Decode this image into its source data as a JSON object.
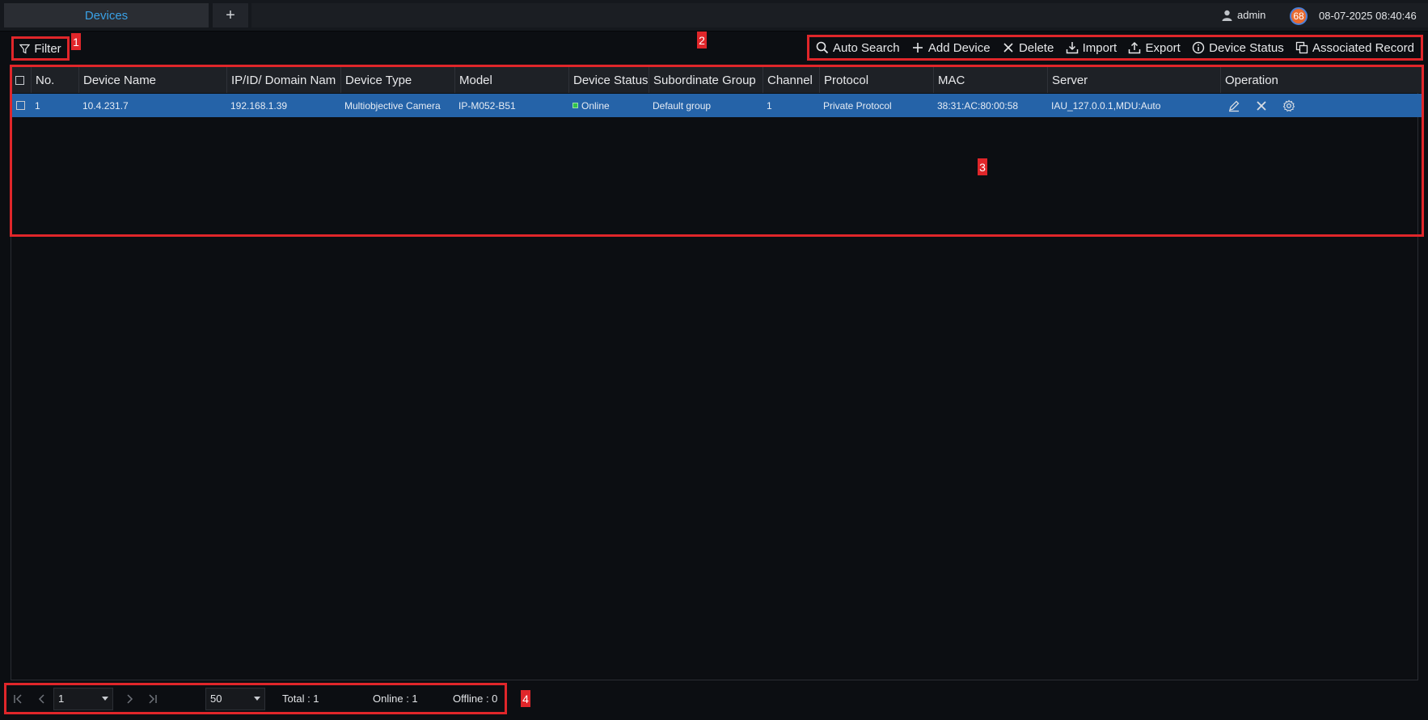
{
  "topbar": {
    "tab_label": "Devices",
    "add_tab": "+",
    "user": "admin",
    "badge": "68",
    "datetime": "08-07-2025 08:40:46"
  },
  "filter": {
    "label": "Filter"
  },
  "markers": [
    "1",
    "2",
    "3",
    "4"
  ],
  "toolbar": {
    "items": [
      {
        "label": "Auto Search",
        "icon": "search-icon"
      },
      {
        "label": "Add Device",
        "icon": "plus-icon"
      },
      {
        "label": "Delete",
        "icon": "close-icon"
      },
      {
        "label": "Import",
        "icon": "import-icon"
      },
      {
        "label": "Export",
        "icon": "export-icon"
      },
      {
        "label": "Device Status",
        "icon": "info-icon"
      },
      {
        "label": "Associated Record",
        "icon": "copy-icon"
      }
    ]
  },
  "table": {
    "columns": [
      "No.",
      "Device Name",
      "IP/ID/ Domain Nam",
      "Device Type",
      "Model",
      "Device Status",
      "Subordinate Group",
      "Channel",
      "Protocol",
      "MAC",
      "Server",
      "Operation"
    ],
    "rows": [
      {
        "no": "1",
        "device_name": "10.4.231.7",
        "ip": "192.168.1.39",
        "device_type": "Multiobjective Camera",
        "model": "IP-M052-B51",
        "status": "Online",
        "group": "Default group",
        "channel": "1",
        "protocol": "Private Protocol",
        "mac": "38:31:AC:80:00:58",
        "server": "IAU_127.0.0.1,MDU:Auto"
      }
    ]
  },
  "pager": {
    "page": "1",
    "page_size": "50",
    "total": "Total : 1",
    "online": "Online : 1",
    "offline": "Offline : 0"
  },
  "colors": {
    "accent": "#3aa1e6",
    "row_selected": "#2563a8",
    "annotation": "#e0262a",
    "online": "#31c24d"
  }
}
